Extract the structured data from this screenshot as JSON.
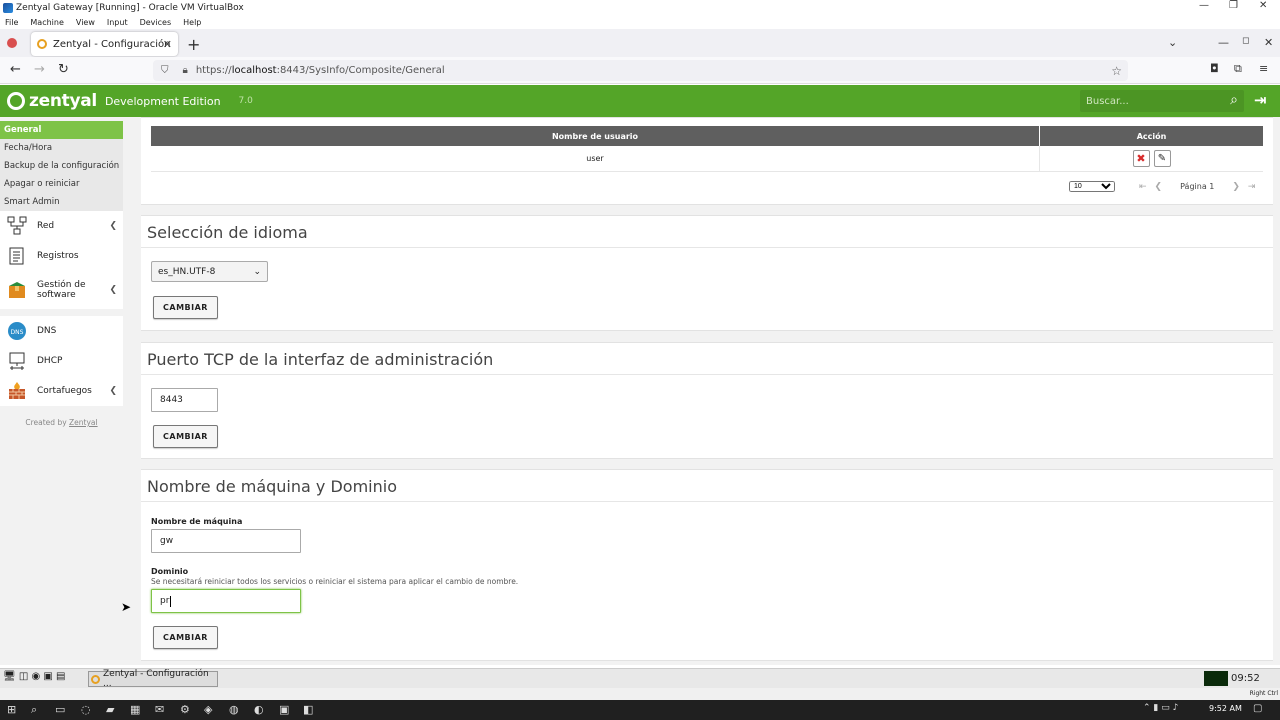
{
  "vbox": {
    "title": "Zentyal Gateway [Running] - Oracle VM VirtualBox",
    "menu": [
      "File",
      "Machine",
      "View",
      "Input",
      "Devices",
      "Help"
    ],
    "status_right": "Right Ctrl"
  },
  "browser": {
    "tab_title": "Zentyal - Configuración",
    "url_prefix": "https://",
    "url_host": "localhost",
    "url_rest": ":8443/SysInfo/Composite/General"
  },
  "header": {
    "logo": "zentyal",
    "edition": "Development Edition",
    "version": "7.0",
    "search_placeholder": "Buscar..."
  },
  "sidebar": {
    "subitems": [
      {
        "label": "General",
        "active": true
      },
      {
        "label": "Fecha/Hora",
        "active": false
      },
      {
        "label": "Backup de la configuración",
        "active": false
      },
      {
        "label": "Apagar o reiniciar",
        "active": false
      },
      {
        "label": "Smart Admin",
        "active": false
      }
    ],
    "items": [
      {
        "label": "Red",
        "icon": "network-icon",
        "has_submenu": true
      },
      {
        "label": "Registros",
        "icon": "logs-icon",
        "has_submenu": false
      },
      {
        "label": "Gestión de software",
        "icon": "package-icon",
        "has_submenu": true
      },
      {
        "label": "DNS",
        "icon": "dns-icon",
        "has_submenu": false
      },
      {
        "label": "DHCP",
        "icon": "dhcp-icon",
        "has_submenu": false
      },
      {
        "label": "Cortafuegos",
        "icon": "firewall-icon",
        "has_submenu": true
      }
    ],
    "created_by_prefix": "Created by",
    "created_by_link": "Zentyal"
  },
  "users_table": {
    "columns": [
      "Nombre de usuario",
      "Acción"
    ],
    "rows": [
      {
        "username": "user"
      }
    ],
    "page_size": "10",
    "page_label": "Página 1"
  },
  "language": {
    "title": "Selección de idioma",
    "selected": "es_HN.UTF-8",
    "button": "CAMBIAR"
  },
  "port": {
    "title": "Puerto TCP de la interfaz de administración",
    "value": "8443",
    "button": "CAMBIAR"
  },
  "hostname": {
    "title": "Nombre de máquina y Dominio",
    "hostname_label": "Nombre de máquina",
    "hostname_value": "gw",
    "domain_label": "Dominio",
    "domain_help": "Se necesitará reiniciar todos los servicios o reiniciar el sistema para aplicar el cambio de nombre.",
    "domain_value": "pr",
    "button": "CAMBIAR"
  },
  "guest_taskbar": {
    "task": "Zentyal - Configuración ...",
    "clock": "09:52"
  },
  "windows_taskbar": {
    "clock": "9:52 AM"
  },
  "colors": {
    "zentyal_green": "#54a528",
    "active_green": "#7ec347",
    "table_header": "#5f5f5f"
  }
}
